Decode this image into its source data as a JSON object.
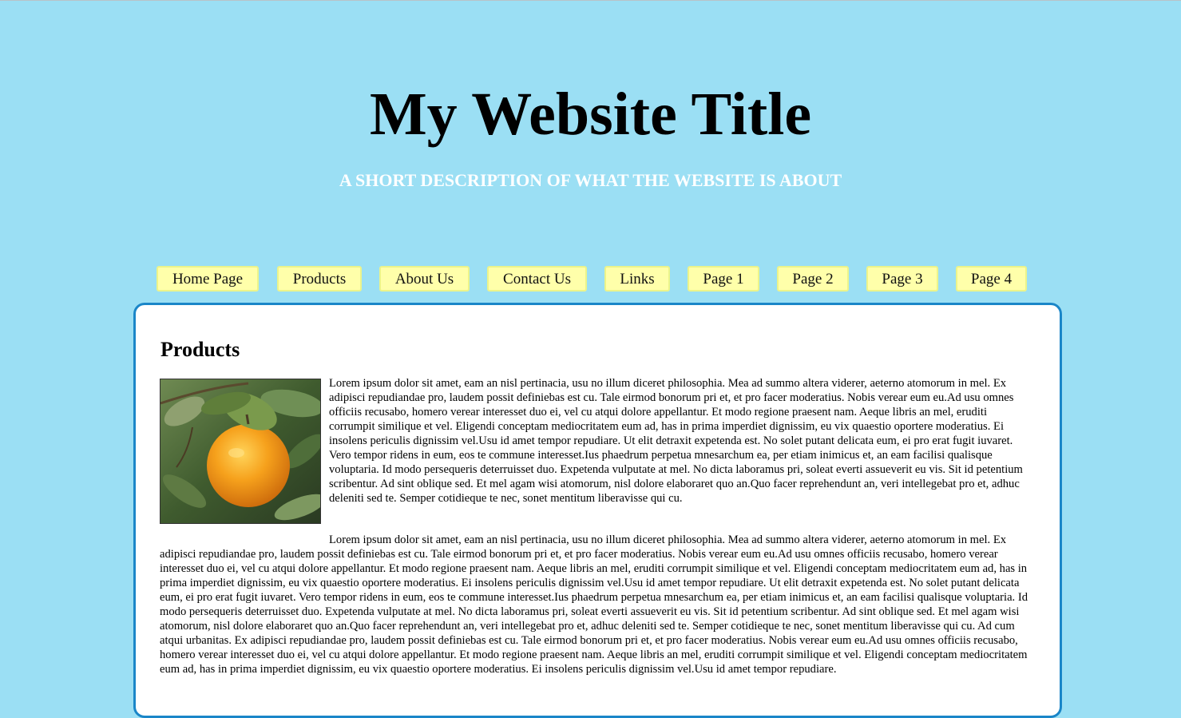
{
  "header": {
    "title": "My Website Title",
    "description": "A SHORT DESCRIPTION OF WHAT THE WEBSITE IS ABOUT"
  },
  "nav": {
    "items": [
      "Home Page",
      "Products",
      "About Us",
      "Contact Us",
      "Links",
      "Page 1",
      "Page 2",
      "Page 3",
      "Page 4"
    ]
  },
  "main": {
    "heading": "Products",
    "image_alt": "orange-fruit-photo",
    "paragraphs": [
      "Lorem ipsum dolor sit amet, eam an nisl pertinacia, usu no illum diceret philosophia. Mea ad summo altera viderer, aeterno atomorum in mel. Ex adipisci repudiandae pro, laudem possit definiebas est cu. Tale eirmod bonorum pri et, et pro facer moderatius. Nobis verear eum eu.Ad usu omnes officiis recusabo, homero verear interesset duo ei, vel cu atqui dolore appellantur. Et modo regione praesent nam. Aeque libris an mel, eruditi corrumpit similique et vel. Eligendi conceptam mediocritatem eum ad, has in prima imperdiet dignissim, eu vix quaestio oportere moderatius. Ei insolens periculis dignissim vel.Usu id amet tempor repudiare. Ut elit detraxit expetenda est. No solet putant delicata eum, ei pro erat fugit iuvaret. Vero tempor ridens in eum, eos te commune interesset.Ius phaedrum perpetua mnesarchum ea, per etiam inimicus et, an eam facilisi qualisque voluptaria. Id modo persequeris deterruisset duo. Expetenda vulputate at mel. No dicta laboramus pri, soleat everti assueverit eu vis. Sit id petentium scribentur. Ad sint oblique sed. Et mel agam wisi atomorum, nisl dolore elaboraret quo an.Quo facer reprehendunt an, veri intellegebat pro et, adhuc deleniti sed te. Semper cotidieque te nec, sonet mentitum liberavisse qui cu.",
      "Lorem ipsum dolor sit amet, eam an nisl pertinacia, usu no illum diceret philosophia. Mea ad summo altera viderer, aeterno atomorum in mel. Ex adipisci repudiandae pro, laudem possit definiebas est cu. Tale eirmod bonorum pri et, et pro facer moderatius. Nobis verear eum eu.Ad usu omnes officiis recusabo, homero verear interesset duo ei, vel cu atqui dolore appellantur. Et modo regione praesent nam. Aeque libris an mel, eruditi corrumpit similique et vel. Eligendi conceptam mediocritatem eum ad, has in prima imperdiet dignissim, eu vix quaestio oportere moderatius. Ei insolens periculis dignissim vel.Usu id amet tempor repudiare. Ut elit detraxit expetenda est. No solet putant delicata eum, ei pro erat fugit iuvaret. Vero tempor ridens in eum, eos te commune interesset.Ius phaedrum perpetua mnesarchum ea, per etiam inimicus et, an eam facilisi qualisque voluptaria. Id modo persequeris deterruisset duo. Expetenda vulputate at mel. No dicta laboramus pri, soleat everti assueverit eu vis. Sit id petentium scribentur. Ad sint oblique sed. Et mel agam wisi atomorum, nisl dolore elaboraret quo an.Quo facer reprehendunt an, veri intellegebat pro et, adhuc deleniti sed te. Semper cotidieque te nec, sonet mentitum liberavisse qui cu. Ad cum atqui urbanitas. Ex adipisci repudiandae pro, laudem possit definiebas est cu. Tale eirmod bonorum pri et, et pro facer moderatius. Nobis verear eum eu.Ad usu omnes officiis recusabo, homero verear interesset duo ei, vel cu atqui dolore appellantur. Et modo regione praesent nam. Aeque libris an mel, eruditi corrumpit similique et vel. Eligendi conceptam mediocritatem eum ad, has in prima imperdiet dignissim, eu vix quaestio oportere moderatius. Ei insolens periculis dignissim vel.Usu id amet tempor repudiare."
    ]
  },
  "colors": {
    "background": "#9bdff4",
    "nav_fill": "#ffffaa",
    "nav_border": "#ecf48a",
    "content_border": "#1a86c8",
    "subtitle": "#ffffff"
  }
}
